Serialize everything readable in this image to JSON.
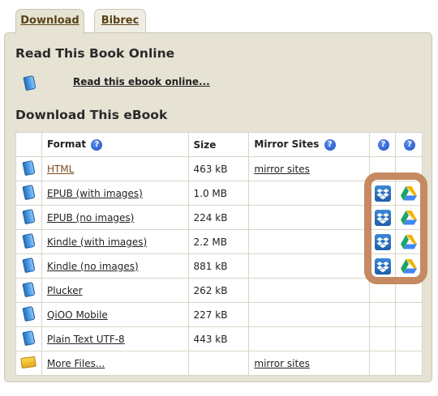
{
  "tabs": [
    {
      "label": "Download",
      "active": true
    },
    {
      "label": "Bibrec",
      "active": false
    }
  ],
  "read_section": {
    "title": "Read This Book Online",
    "link": "Read this ebook online..."
  },
  "download_section": {
    "title": "Download This eBook",
    "columns": {
      "format": "Format",
      "size": "Size",
      "mirror": "Mirror Sites"
    },
    "help_glyph": "?",
    "rows": [
      {
        "format": "HTML",
        "size": "463 kB",
        "mirror": "mirror sites",
        "icon": "book-icon",
        "cloud": false
      },
      {
        "format": "EPUB (with images)",
        "size": "1.0 MB",
        "mirror": "",
        "icon": "book-icon",
        "cloud": true
      },
      {
        "format": "EPUB (no images)",
        "size": "224 kB",
        "mirror": "",
        "icon": "book-icon",
        "cloud": true
      },
      {
        "format": "Kindle (with images)",
        "size": "2.2 MB",
        "mirror": "",
        "icon": "book-icon",
        "cloud": true
      },
      {
        "format": "Kindle (no images)",
        "size": "881 kB",
        "mirror": "",
        "icon": "book-icon",
        "cloud": true
      },
      {
        "format": "Plucker",
        "size": "262 kB",
        "mirror": "",
        "icon": "book-icon",
        "cloud": false
      },
      {
        "format": "QiOO Mobile",
        "size": "227 kB",
        "mirror": "",
        "icon": "book-icon",
        "cloud": false
      },
      {
        "format": "Plain Text UTF-8",
        "size": "443 kB",
        "mirror": "",
        "icon": "book-icon",
        "cloud": false
      },
      {
        "format": "More Files...",
        "size": "",
        "mirror": "mirror sites",
        "icon": "folder-icon",
        "cloud": false
      }
    ]
  },
  "colors": {
    "panel": "#e6e3d5",
    "highlight": "#c58a61",
    "tab_text": "#5a4418"
  }
}
